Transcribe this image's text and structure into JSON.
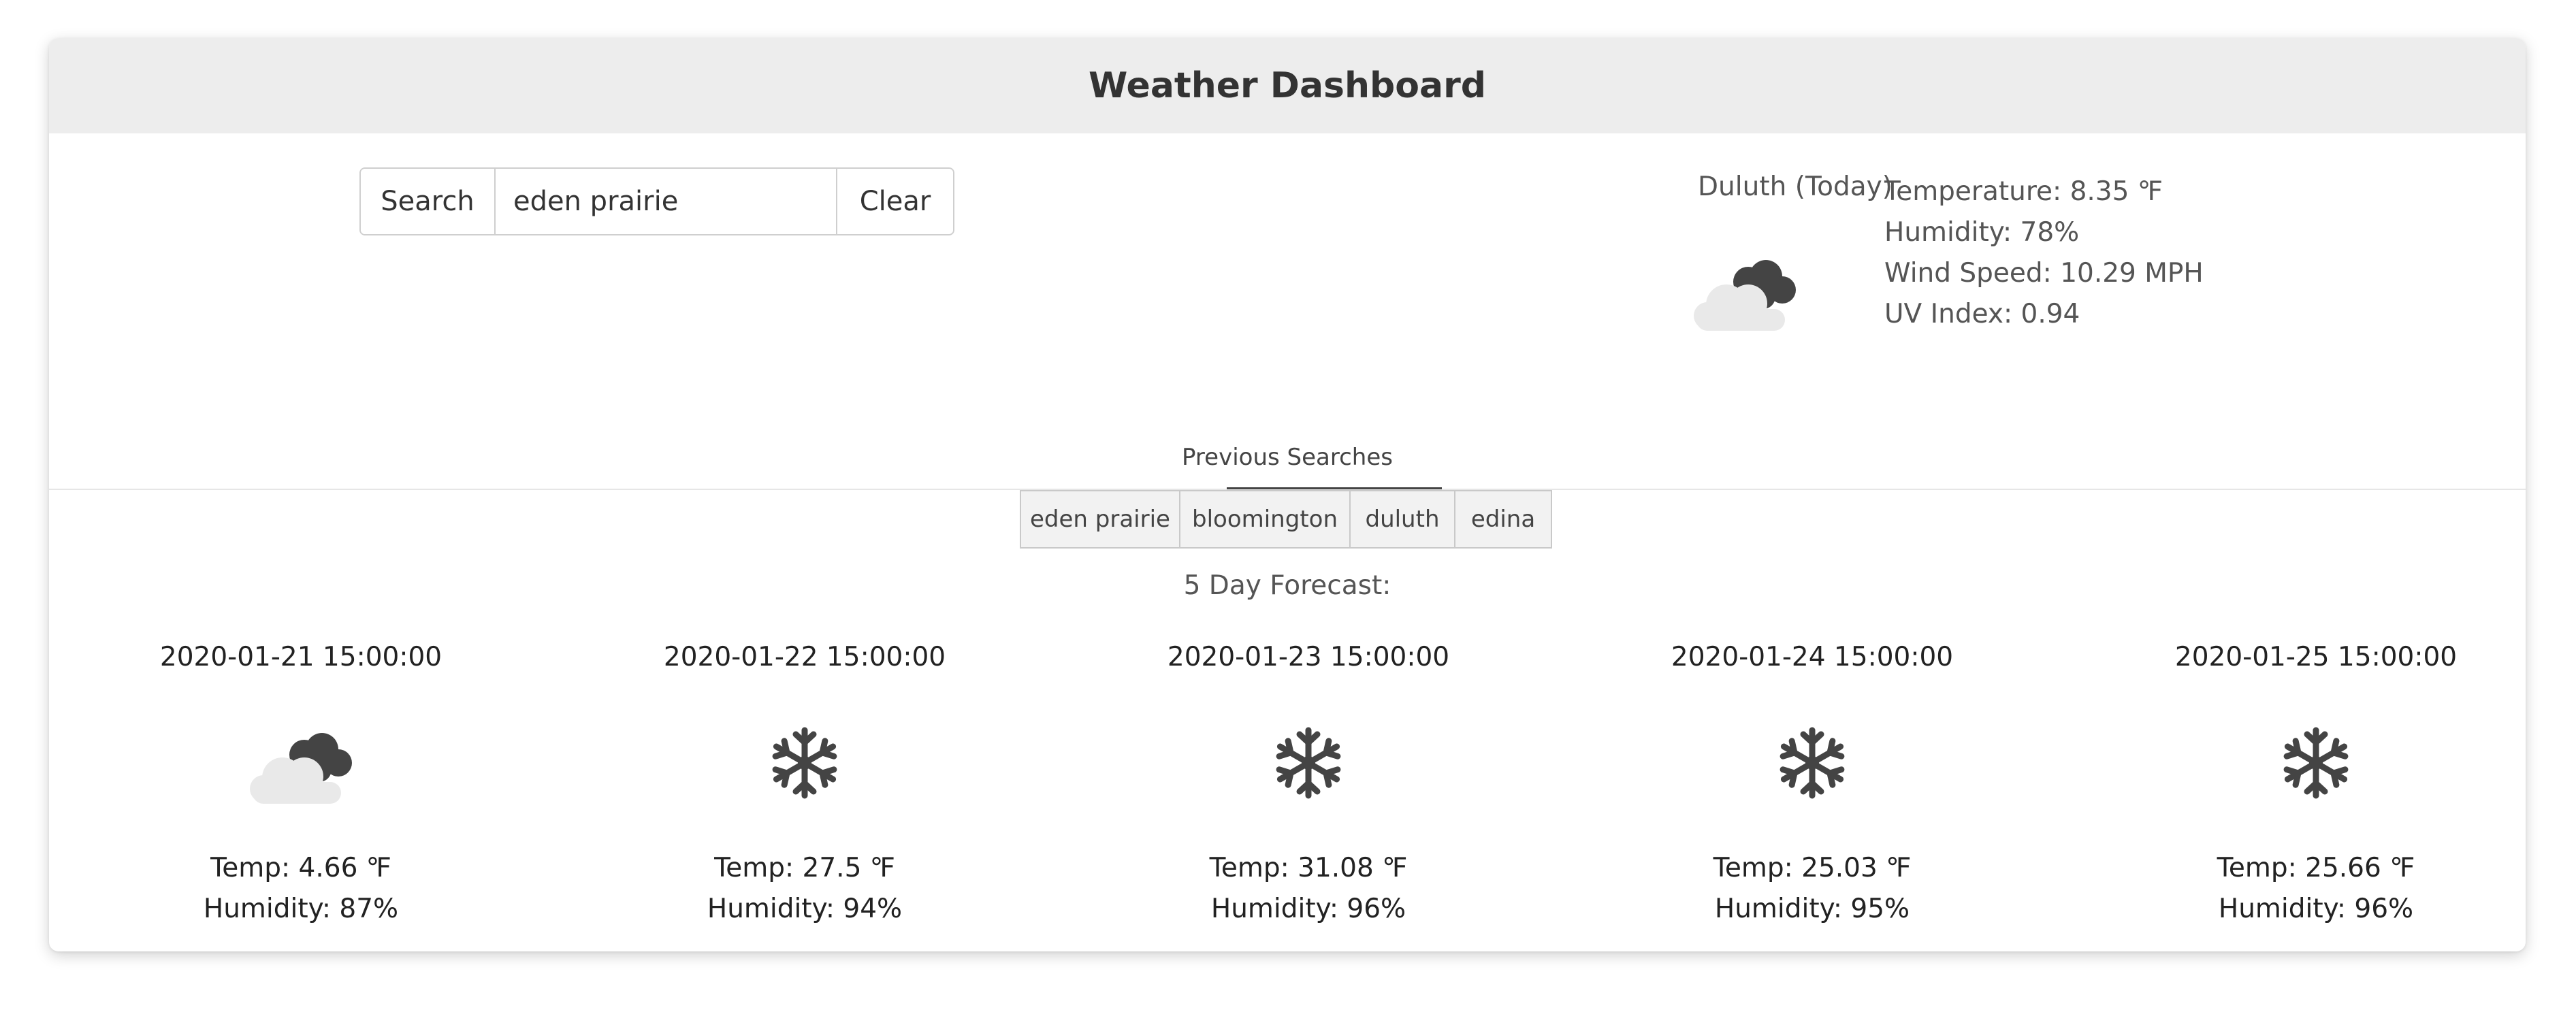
{
  "header": {
    "title": "Weather Dashboard"
  },
  "search": {
    "button_label": "Search",
    "value": "eden prairie",
    "clear_label": "Clear"
  },
  "current": {
    "city": "Duluth (Today)",
    "icon": "cloudy-icon",
    "temperature": "Temperature: 8.35 ℉",
    "humidity": "Humidity: 78%",
    "wind": "Wind Speed: 10.29 MPH",
    "uv": "UV Index: 0.94"
  },
  "previous": {
    "title": "Previous Searches",
    "items": [
      "eden prairie",
      "bloomington",
      "duluth",
      "edina"
    ]
  },
  "forecast": {
    "title": "5 Day Forecast:",
    "days": [
      {
        "date": "2020-01-21 15:00:00",
        "icon": "cloudy-icon",
        "temp": "Temp: 4.66 ℉",
        "humidity": "Humidity: 87%"
      },
      {
        "date": "2020-01-22 15:00:00",
        "icon": "snowflake-icon",
        "temp": "Temp: 27.5 ℉",
        "humidity": "Humidity: 94%"
      },
      {
        "date": "2020-01-23 15:00:00",
        "icon": "snowflake-icon",
        "temp": "Temp: 31.08 ℉",
        "humidity": "Humidity: 96%"
      },
      {
        "date": "2020-01-24 15:00:00",
        "icon": "snowflake-icon",
        "temp": "Temp: 25.03 ℉",
        "humidity": "Humidity: 95%"
      },
      {
        "date": "2020-01-25 15:00:00",
        "icon": "snowflake-icon",
        "temp": "Temp: 25.66 ℉",
        "humidity": "Humidity: 96%"
      }
    ]
  }
}
